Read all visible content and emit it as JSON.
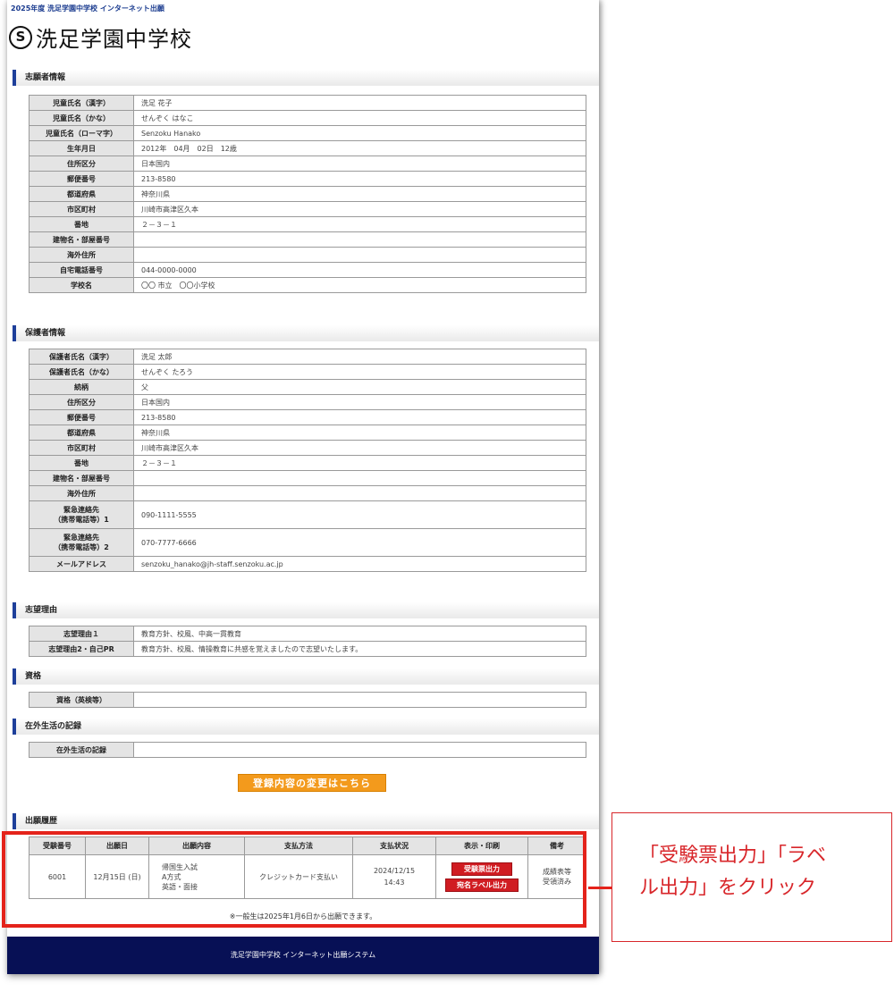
{
  "header": {
    "top_text": "2025年度 洗足学園中学校 インターネット出願",
    "logo_glyph": "S",
    "school_name": "洗足学園中学校"
  },
  "applicant": {
    "title": "志願者情報",
    "rows": [
      {
        "label": "児童氏名（漢字）",
        "value": "洗足 花子"
      },
      {
        "label": "児童氏名（かな）",
        "value": "せんぞく はなこ"
      },
      {
        "label": "児童氏名（ローマ字）",
        "value": "Senzoku Hanako"
      },
      {
        "label": "生年月日",
        "value": "2012年　04月　02日　12歳"
      },
      {
        "label": "住所区分",
        "value": "日本国内"
      },
      {
        "label": "郵便番号",
        "value": "213-8580"
      },
      {
        "label": "都道府県",
        "value": "神奈川県"
      },
      {
        "label": "市区町村",
        "value": "川崎市高津区久本"
      },
      {
        "label": "番地",
        "value": "２－３－１"
      },
      {
        "label": "建物名・部屋番号",
        "value": ""
      },
      {
        "label": "海外住所",
        "value": ""
      },
      {
        "label": "自宅電話番号",
        "value": "044-0000-0000"
      },
      {
        "label": "学校名",
        "value": "〇〇 市立　〇〇小学校"
      }
    ]
  },
  "guardian": {
    "title": "保護者情報",
    "rows": [
      {
        "label": "保護者氏名（漢字）",
        "value": "洗足 太郎"
      },
      {
        "label": "保護者氏名（かな）",
        "value": "せんぞく たろう"
      },
      {
        "label": "続柄",
        "value": "父"
      },
      {
        "label": "住所区分",
        "value": "日本国内"
      },
      {
        "label": "郵便番号",
        "value": "213-8580"
      },
      {
        "label": "都道府県",
        "value": "神奈川県"
      },
      {
        "label": "市区町村",
        "value": "川崎市高津区久本"
      },
      {
        "label": "番地",
        "value": "２－３－１"
      },
      {
        "label": "建物名・部屋番号",
        "value": ""
      },
      {
        "label": "海外住所",
        "value": ""
      },
      {
        "label": "緊急連絡先\n（携帯電話等）1",
        "value": "090-1111-5555"
      },
      {
        "label": "緊急連絡先\n（携帯電話等）2",
        "value": "070-7777-6666"
      },
      {
        "label": "メールアドレス",
        "value": "senzoku_hanako@jh-staff.senzoku.ac.jp"
      }
    ]
  },
  "motive": {
    "title": "志望理由",
    "rows": [
      {
        "label": "志望理由１",
        "value": "教育方針、校風、中高一貫教育"
      },
      {
        "label": "志望理由2・自己PR",
        "value": "教育方針、校風、情操教育に共感を覚えましたので志望いたします。"
      }
    ]
  },
  "qualification": {
    "title": "資格",
    "rows": [
      {
        "label": "資格（英検等）",
        "value": ""
      }
    ]
  },
  "overseas": {
    "title": "在外生活の記録",
    "rows": [
      {
        "label": "在外生活の記録",
        "value": ""
      }
    ]
  },
  "edit_button": "登録内容の変更はこちら",
  "history": {
    "title": "出願履歴",
    "headers": [
      "受験番号",
      "出願日",
      "出願内容",
      "支払方法",
      "支払状況",
      "表示・印刷",
      "備考"
    ],
    "row": {
      "number": "6001",
      "date": "12月15日 (日)",
      "content_1": "帰国生入試",
      "content_2": "A方式",
      "content_3": "英語・面接",
      "payment_method": "クレジットカード支払い",
      "payment_date": "2024/12/15",
      "payment_time": "14:43",
      "btn_ticket": "受験票出力",
      "btn_label": "宛名ラベル出力",
      "remark_1": "成績表等",
      "remark_2": "受領済み"
    },
    "note": "※一般生は2025年1月6日から出願できます。"
  },
  "footer": "洗足学園中学校 インターネット出願システム",
  "callout": {
    "line1": "「受験票出力」「ラベ",
    "line2": "ル出力」をクリック"
  },
  "colors": {
    "accent_blue": "#1e3f9a",
    "edit_orange": "#f39a1c",
    "button_red": "#d01c22",
    "highlight_red": "#e4231b",
    "footer_navy": "#071055"
  }
}
